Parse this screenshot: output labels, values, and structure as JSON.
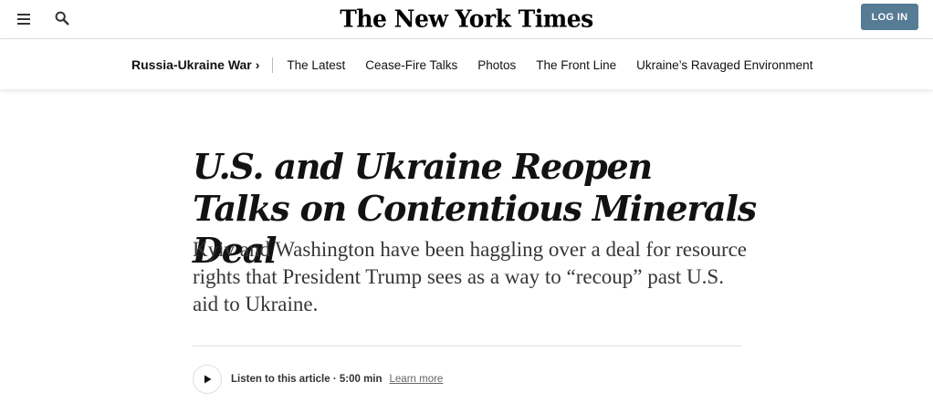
{
  "header": {
    "logo_text": "The New York Times",
    "login_label": "LOG IN",
    "login_color": "#567b95",
    "menu_icon": "hamburger-menu-icon",
    "search_icon": "search-icon"
  },
  "section_nav": {
    "section_label": "Russia-Ukraine War",
    "section_chevron": "›",
    "links": [
      {
        "label": "The Latest"
      },
      {
        "label": "Cease-Fire Talks"
      },
      {
        "label": "Photos"
      },
      {
        "label": "The Front Line"
      },
      {
        "label": "Ukraine’s Ravaged Environment"
      }
    ]
  },
  "article": {
    "headline": "U.S. and Ukraine Reopen Talks on Contentious Minerals Deal",
    "summary": "Kyiv and Washington have been haggling over a deal for resource rights that President Trump sees as a way to “recoup” past U.S. aid to Ukraine.",
    "listen": {
      "label": "Listen to this article · 5:00 min",
      "learn_more": "Learn more",
      "play_icon": "play-icon"
    }
  }
}
